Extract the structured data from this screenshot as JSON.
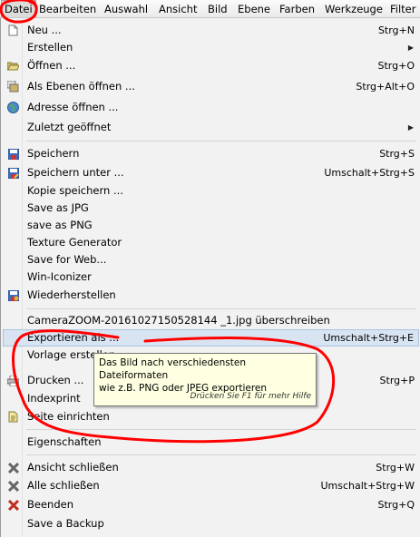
{
  "menubar": {
    "items": [
      "Datei",
      "Bearbeiten",
      "Auswahl",
      "Ansicht",
      "Bild",
      "Ebene",
      "Farben",
      "Werkzeuge",
      "Filter"
    ]
  },
  "menu": {
    "items": [
      {
        "label": "Neu ...",
        "shortcut": "Strg+N",
        "icon": "new-file-icon"
      },
      {
        "label": "Erstellen",
        "shortcut": "",
        "submenu": "▶"
      },
      {
        "label": "Öffnen ...",
        "shortcut": "Strg+O",
        "icon": "open-folder-icon"
      },
      {
        "label": "Als Ebenen öffnen ...",
        "shortcut": "Strg+Alt+O",
        "icon": "open-as-layers-icon"
      },
      {
        "label": "Adresse öffnen ...",
        "shortcut": "",
        "icon": "globe-icon"
      },
      {
        "label": "Zuletzt geöffnet",
        "shortcut": "",
        "submenu": "▶"
      },
      {
        "label": "Speichern",
        "shortcut": "Strg+S",
        "icon": "save-icon"
      },
      {
        "label": "Speichern unter ...",
        "shortcut": "Umschalt+Strg+S",
        "icon": "save-as-icon"
      },
      {
        "label": "Kopie speichern ...",
        "shortcut": ""
      },
      {
        "label": "Save as JPG",
        "shortcut": ""
      },
      {
        "label": "save as PNG",
        "shortcut": ""
      },
      {
        "label": "Texture Generator",
        "shortcut": ""
      },
      {
        "label": "Save for Web...",
        "shortcut": ""
      },
      {
        "label": "Win-Iconizer",
        "shortcut": ""
      },
      {
        "label": "Wiederherstellen",
        "shortcut": "",
        "icon": "revert-icon"
      },
      {
        "label": "CameraZOOM-20161027150528144 _1.jpg überschreiben",
        "shortcut": ""
      },
      {
        "label": "Exportieren als ...",
        "shortcut": "Umschalt+Strg+E"
      },
      {
        "label": "Vorlage erstellen ...",
        "shortcut": ""
      },
      {
        "label": "Drucken ...",
        "shortcut": "Strg+P",
        "icon": "print-icon"
      },
      {
        "label": "Indexprint",
        "shortcut": ""
      },
      {
        "label": "Seite einrichten",
        "shortcut": "",
        "icon": "page-setup-icon"
      },
      {
        "label": "Eigenschaften",
        "shortcut": ""
      },
      {
        "label": "Ansicht schließen",
        "shortcut": "Strg+W",
        "icon": "close-view-icon"
      },
      {
        "label": "Alle schließen",
        "shortcut": "Umschalt+Strg+W",
        "icon": "close-all-icon"
      },
      {
        "label": "Beenden",
        "shortcut": "Strg+Q",
        "icon": "quit-icon"
      },
      {
        "label": "Save a Backup",
        "shortcut": ""
      }
    ]
  },
  "tooltip": {
    "line1": "Das Bild nach verschiedensten Dateiformaten",
    "line2": "wie z.B. PNG oder JPEG exportieren",
    "hint": "Drücken Sie F1 für mehr Hilfe"
  },
  "colors": {
    "annotation": "#ff0000",
    "hover": "#d8e4f2",
    "tooltip_bg": "#ffffe1"
  }
}
